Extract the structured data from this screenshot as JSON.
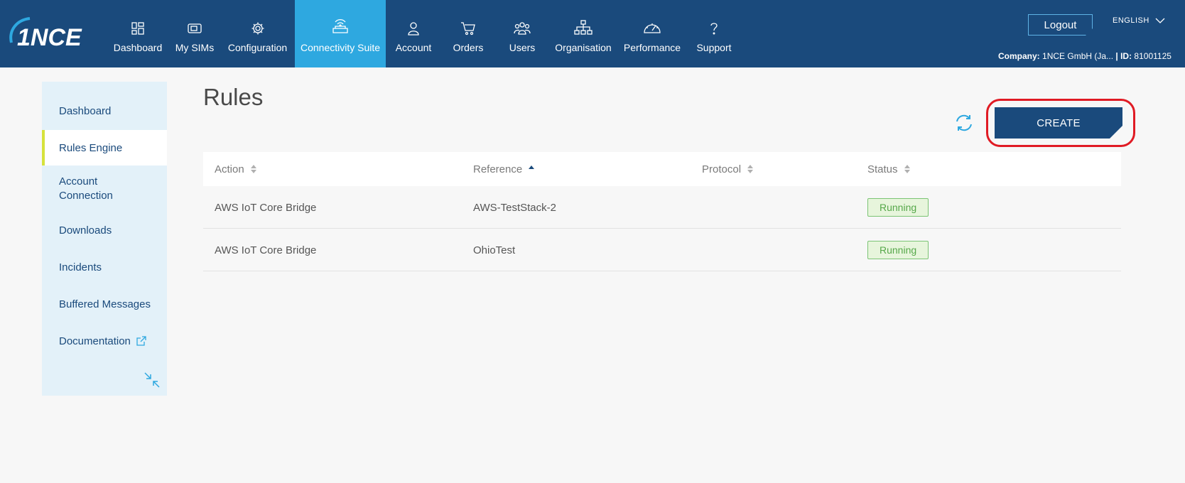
{
  "brand": {
    "logo_text": "1NCE"
  },
  "nav": {
    "items": [
      {
        "label": "Dashboard",
        "icon": "dashboard-icon"
      },
      {
        "label": "My SIMs",
        "icon": "sim-icon"
      },
      {
        "label": "Configuration",
        "icon": "gear-icon"
      },
      {
        "label": "Connectivity Suite",
        "icon": "connectivity-icon",
        "active": true
      },
      {
        "label": "Account",
        "icon": "person-icon"
      },
      {
        "label": "Orders",
        "icon": "cart-icon"
      },
      {
        "label": "Users",
        "icon": "users-icon"
      },
      {
        "label": "Organisation",
        "icon": "org-chart-icon"
      },
      {
        "label": "Performance",
        "icon": "gauge-icon"
      },
      {
        "label": "Support",
        "icon": "question-icon"
      }
    ],
    "logout_label": "Logout",
    "language": "ENGLISH",
    "company_label": "Company:",
    "company_value": "1NCE GmbH (Ja...",
    "id_label": "| ID:",
    "id_value": "81001125"
  },
  "sidebar": {
    "items": [
      {
        "label": "Dashboard"
      },
      {
        "label": "Rules Engine",
        "active": true
      },
      {
        "label": "Account Connection"
      },
      {
        "label": "Downloads"
      },
      {
        "label": "Incidents"
      },
      {
        "label": "Buffered Messages"
      },
      {
        "label": "Documentation",
        "external": true
      }
    ]
  },
  "main": {
    "title": "Rules",
    "create_label": "CREATE",
    "table": {
      "columns": [
        "Action",
        "Reference",
        "Protocol",
        "Status"
      ],
      "sorted_column": "Reference",
      "sort_direction": "ascending",
      "rows": [
        {
          "action": "AWS IoT Core Bridge",
          "reference": "AWS-TestStack-2",
          "protocol": "",
          "status": "Running"
        },
        {
          "action": "AWS IoT Core Bridge",
          "reference": "OhioTest",
          "protocol": "",
          "status": "Running"
        }
      ]
    }
  },
  "colors": {
    "header_bg": "#1a4a7c",
    "active_nav": "#2ea8e0",
    "sidebar_bg": "#e3f1f9",
    "active_marker": "#d6e23c",
    "running_green": "#56a84a",
    "annotation_red": "#e01b24"
  }
}
